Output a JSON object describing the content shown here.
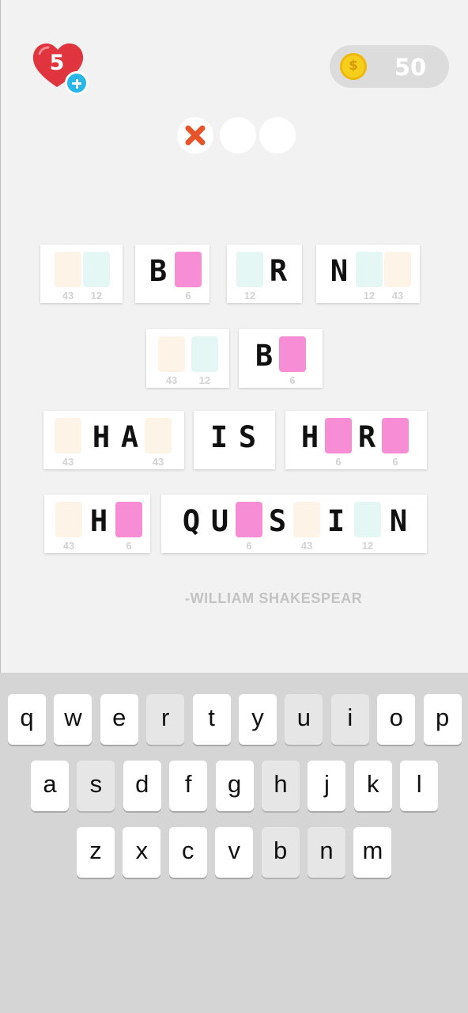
{
  "header": {
    "lives": "5",
    "coins": "50",
    "coin_symbol": "$",
    "mistakes": [
      {
        "state": "wrong",
        "icon": "x-icon",
        "color": "#e8542a"
      },
      {
        "state": "empty"
      },
      {
        "state": "empty"
      }
    ]
  },
  "colors": {
    "heart": "#e0343e",
    "plus_badge": "#29b6e8",
    "cell_cream": "#fdf3e6",
    "cell_mint": "#e4f7f5",
    "cell_selected": "#f78dd4"
  },
  "puzzle": {
    "words": [
      {
        "cells": [
          {
            "letter": "",
            "number": "43",
            "style": "cream"
          },
          {
            "letter": "",
            "number": "12",
            "style": "mint"
          }
        ]
      },
      {
        "cells": [
          {
            "letter": "B",
            "number": ""
          },
          {
            "letter": "",
            "number": "6",
            "style": "pink"
          }
        ]
      },
      {
        "cells": [
          {
            "letter": "",
            "number": "12",
            "style": "mint"
          },
          {
            "letter": "R",
            "number": ""
          }
        ]
      },
      {
        "cells": [
          {
            "letter": "N",
            "number": ""
          },
          {
            "letter": "",
            "number": "12",
            "style": "mint"
          },
          {
            "letter": "",
            "number": "43",
            "style": "cream"
          }
        ]
      },
      {
        "cells": [
          {
            "letter": "",
            "number": "43",
            "style": "cream"
          },
          {
            "letter": "",
            "number": "12",
            "style": "mint"
          }
        ]
      },
      {
        "cells": [
          {
            "letter": "B",
            "number": ""
          },
          {
            "letter": "",
            "number": "6",
            "style": "pink"
          }
        ]
      },
      {
        "cells": [
          {
            "letter": "",
            "number": "43",
            "style": "cream"
          },
          {
            "letter": "H",
            "number": ""
          },
          {
            "letter": "A",
            "number": ""
          },
          {
            "letter": "",
            "number": "43",
            "style": "cream"
          }
        ]
      },
      {
        "cells": [
          {
            "letter": "I",
            "number": ""
          },
          {
            "letter": "S",
            "number": ""
          }
        ]
      },
      {
        "cells": [
          {
            "letter": "H",
            "number": ""
          },
          {
            "letter": "",
            "number": "6",
            "style": "pink"
          },
          {
            "letter": "R",
            "number": ""
          },
          {
            "letter": "",
            "number": "6",
            "style": "pink"
          }
        ]
      },
      {
        "cells": [
          {
            "letter": "",
            "number": "43",
            "style": "cream"
          },
          {
            "letter": "H",
            "number": ""
          },
          {
            "letter": "",
            "number": "6",
            "style": "pink"
          }
        ]
      },
      {
        "cells": [
          {
            "letter": "Q",
            "number": ""
          },
          {
            "letter": "U",
            "number": ""
          },
          {
            "letter": "",
            "number": "6",
            "style": "pink"
          },
          {
            "letter": "S",
            "number": ""
          },
          {
            "letter": "",
            "number": "43",
            "style": "cream"
          },
          {
            "letter": "I",
            "number": ""
          },
          {
            "letter": "",
            "number": "12",
            "style": "mint"
          },
          {
            "letter": "N",
            "number": ""
          }
        ]
      }
    ],
    "attribution": "-WILLIAM SHAKESPEAR"
  },
  "keyboard": {
    "rows": [
      [
        "q",
        "w",
        "e",
        "r",
        "t",
        "y",
        "u",
        "i",
        "o",
        "p"
      ],
      [
        "a",
        "s",
        "d",
        "f",
        "g",
        "h",
        "j",
        "k",
        "l"
      ],
      [
        "z",
        "x",
        "c",
        "v",
        "b",
        "n",
        "m"
      ]
    ],
    "disabled": [
      "r",
      "u",
      "i",
      "s",
      "h",
      "b",
      "n"
    ]
  }
}
